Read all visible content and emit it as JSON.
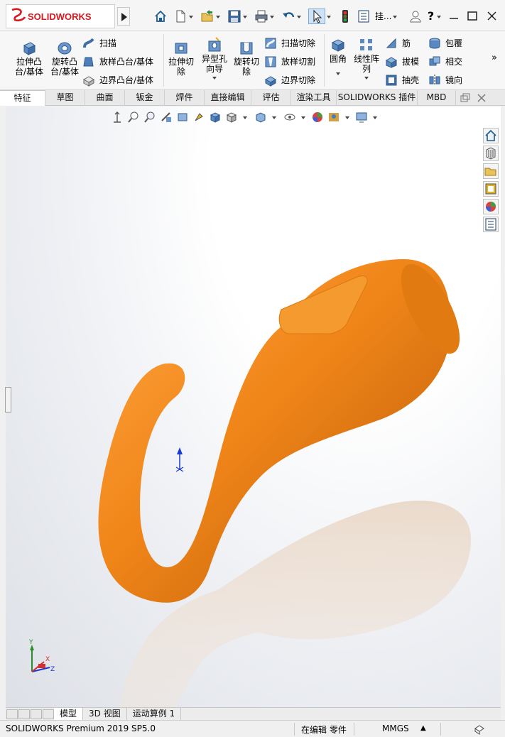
{
  "brand": {
    "ds": "3S",
    "name_part1": "SOLID",
    "name_part2": "WORKS"
  },
  "quick_access": {
    "icons": [
      "home-icon",
      "new-document-icon",
      "open-icon",
      "save-icon",
      "print-icon",
      "undo-icon",
      "select-arrow-icon",
      "rebuild-traffic-light-icon",
      "file-properties-icon"
    ],
    "search_label": "挂...",
    "help_label": "?"
  },
  "ribbon": {
    "features": {
      "extrude_boss": "拉伸凸\n台/基体",
      "revolve_boss": "旋转凸\n台/基体",
      "sweep": "扫描",
      "loft_boss": "放样凸台/基体",
      "boundary_boss": "边界凸台/基体",
      "extrude_cut": "拉伸切\n除",
      "hole_wizard": "异型孔\n向导",
      "revolve_cut": "旋转切\n除",
      "sweep_cut": "扫描切除",
      "loft_cut": "放样切割",
      "boundary_cut": "边界切除",
      "fillet": "圆角",
      "linear_pattern": "线性阵\n列",
      "rib": "筋",
      "draft": "拔模",
      "shell": "抽壳",
      "wrap": "包覆",
      "intersect": "相交",
      "mirror": "镜向"
    }
  },
  "tabs": [
    "特征",
    "草图",
    "曲面",
    "钣金",
    "焊件",
    "直接编辑",
    "评估",
    "渲染工具",
    "SOLIDWORKS 插件",
    "MBD"
  ],
  "active_tab": "特征",
  "bottom_tabs": [
    "模型",
    "3D 视图",
    "运动算例 1"
  ],
  "active_bottom_tab": "模型",
  "status": {
    "product": "SOLIDWORKS Premium 2019 SP5.0",
    "mode": "在编辑 零件",
    "units": "MMGS"
  },
  "triad": {
    "x": "X",
    "y": "Y",
    "z": "Z"
  },
  "colors": {
    "model_orange": "#f08519",
    "brand_red": "#d71920"
  }
}
